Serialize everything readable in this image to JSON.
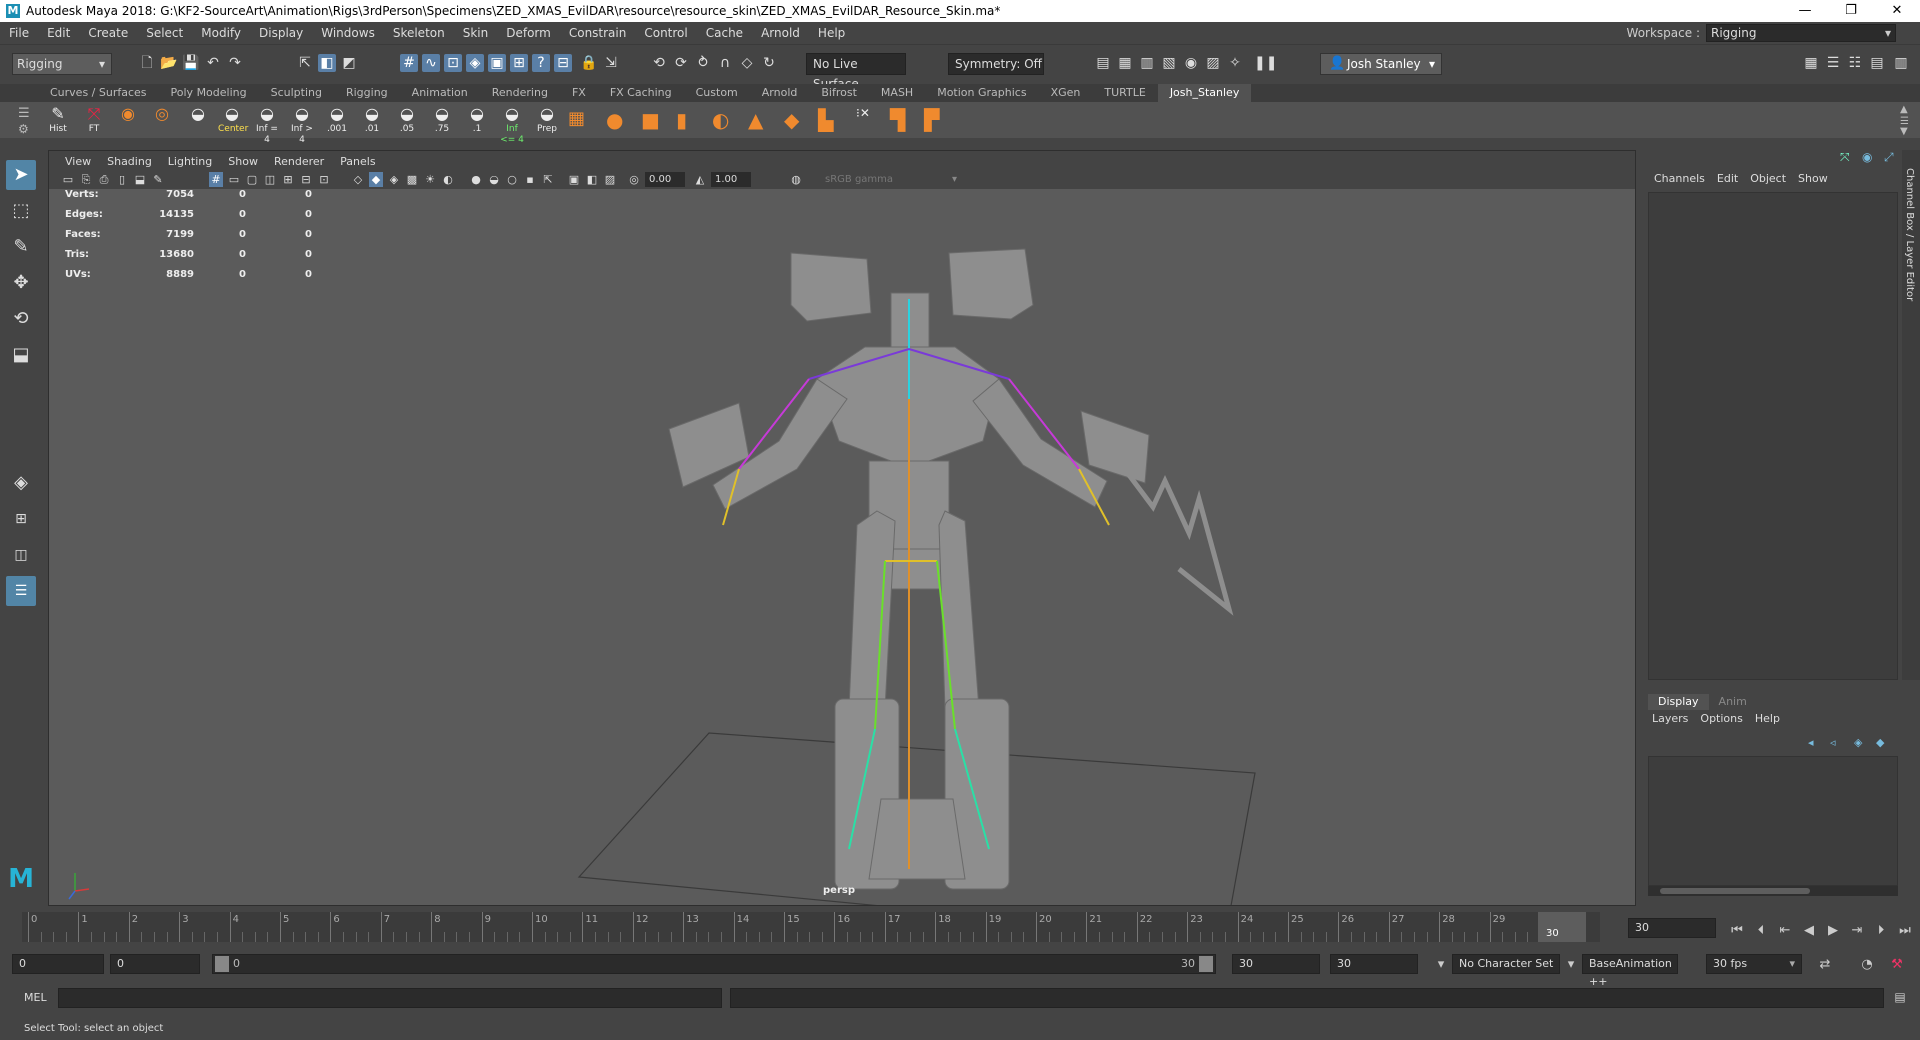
{
  "window": {
    "title": "Autodesk Maya 2018: G:\\KF2-SourceArt\\Animation\\Rigs\\3rdPerson\\Specimens\\ZED_XMAS_EvilDAR\\resource\\resource_skin\\ZED_XMAS_EvilDAR_Resource_Skin.ma*",
    "app_icon": "M"
  },
  "menubar": {
    "items": [
      "File",
      "Edit",
      "Create",
      "Select",
      "Modify",
      "Display",
      "Windows",
      "Skeleton",
      "Skin",
      "Deform",
      "Constrain",
      "Control",
      "Cache",
      "Arnold",
      "Help"
    ],
    "workspace_label": "Workspace :",
    "workspace_value": "Rigging"
  },
  "statusline": {
    "mode": "Rigging",
    "live_surface": "No Live Surface",
    "symmetry": "Symmetry: Off",
    "user": "Josh Stanley"
  },
  "shelf": {
    "tabs": [
      "Curves / Surfaces",
      "Poly Modeling",
      "Sculpting",
      "Rigging",
      "Animation",
      "Rendering",
      "FX",
      "FX Caching",
      "Custom",
      "Arnold",
      "Bifrost",
      "MASH",
      "Motion Graphics",
      "XGen",
      "TURTLE",
      "Josh_Stanley"
    ],
    "active_tab": "Josh_Stanley",
    "buttons": [
      {
        "label": "Hist",
        "icon": "history-icon"
      },
      {
        "label": "FT",
        "icon": "freeze-transform-icon"
      },
      {
        "label": "",
        "icon": "poly-layer-icon"
      },
      {
        "label": "",
        "icon": "poly-stack-icon"
      },
      {
        "label": "",
        "icon": "sphere-half-icon"
      },
      {
        "label": "Center",
        "icon": "center-pivot-icon"
      },
      {
        "label": "Inf = 4",
        "icon": "influence-icon"
      },
      {
        "label": "Inf > 4",
        "icon": "influence-icon"
      },
      {
        "label": ".001",
        "icon": "weight-icon"
      },
      {
        "label": ".01",
        "icon": "weight-icon"
      },
      {
        "label": ".05",
        "icon": "weight-icon"
      },
      {
        "label": ".75",
        "icon": "weight-icon"
      },
      {
        "label": ".1",
        "icon": "weight-icon"
      },
      {
        "label": "Inf <= 4",
        "icon": "influence-icon"
      },
      {
        "label": "Prep",
        "icon": "prep-icon"
      }
    ]
  },
  "viewport": {
    "menus": [
      "View",
      "Shading",
      "Lighting",
      "Show",
      "Renderer",
      "Panels"
    ],
    "near_value": "0.00",
    "far_value": "1.00",
    "color_space": "sRGB gamma",
    "camera_label": "persp",
    "hud": [
      {
        "label": "Verts:",
        "v1": "7054",
        "v2": "0",
        "v3": "0"
      },
      {
        "label": "Edges:",
        "v1": "14135",
        "v2": "0",
        "v3": "0"
      },
      {
        "label": "Faces:",
        "v1": "7199",
        "v2": "0",
        "v3": "0"
      },
      {
        "label": "Tris:",
        "v1": "13680",
        "v2": "0",
        "v3": "0"
      },
      {
        "label": "UVs:",
        "v1": "8889",
        "v2": "0",
        "v3": "0"
      }
    ]
  },
  "channelbox": {
    "menus": [
      "Channels",
      "Edit",
      "Object",
      "Show"
    ],
    "side_label": "Channel Box / Layer Editor"
  },
  "layereditor": {
    "tabs": [
      "Display",
      "Anim"
    ],
    "active_tab": "Display",
    "menus": [
      "Layers",
      "Options",
      "Help"
    ]
  },
  "timeslider": {
    "ticks": [
      "0",
      "1",
      "2",
      "3",
      "4",
      "5",
      "6",
      "7",
      "8",
      "9",
      "10",
      "11",
      "12",
      "13",
      "14",
      "15",
      "16",
      "17",
      "18",
      "19",
      "20",
      "21",
      "22",
      "23",
      "24",
      "25",
      "26",
      "27",
      "28",
      "29",
      "30"
    ],
    "current_frame": "30",
    "current_field": "30"
  },
  "rangeslider": {
    "start": "0",
    "anim_start": "0",
    "range_start_label": "0",
    "range_end_label": "30",
    "playback_end": "30",
    "anim_end": "30",
    "character_set": "No Character Set",
    "anim_layer": "BaseAnimation ++",
    "fps": "30 fps"
  },
  "cmdline": {
    "language": "MEL"
  },
  "helpline": {
    "text": "Select Tool: select an object"
  }
}
